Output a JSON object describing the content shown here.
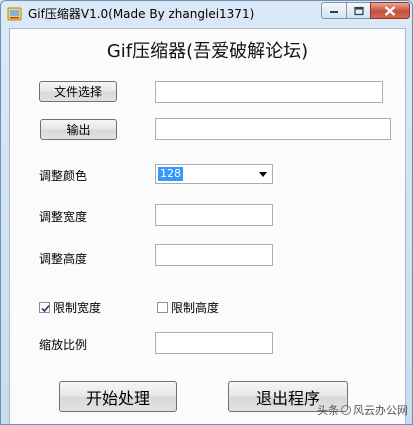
{
  "window": {
    "title": "Gif压缩器V1.0(Made By zhanglei1371)"
  },
  "main": {
    "heading": "Gif压缩器(吾爱破解论坛)",
    "file_button": "文件选择",
    "output_button": "输出",
    "file_path": "",
    "output_path": "",
    "color_label": "调整颜色",
    "color_value": "128",
    "width_label": "调整宽度",
    "width_value": "",
    "height_label": "调整高度",
    "height_value": "",
    "limit_width_label": "限制宽度",
    "limit_width_checked": true,
    "limit_height_label": "限制高度",
    "limit_height_checked": false,
    "scale_label": "缩放比例",
    "scale_value": "",
    "start_button": "开始处理",
    "exit_button": "退出程序"
  },
  "watermark": {
    "prefix": "头条",
    "name": "风云办公网"
  }
}
